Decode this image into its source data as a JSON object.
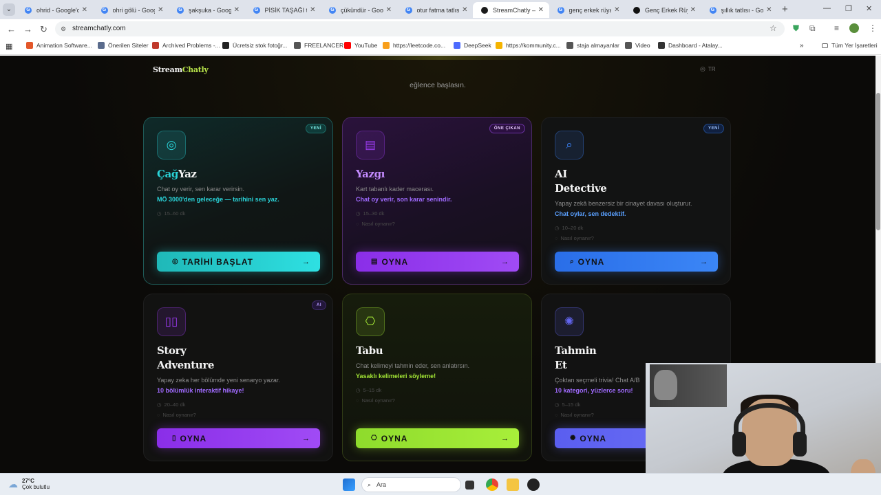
{
  "browser": {
    "tabs": [
      {
        "title": "ohrid - Google'da",
        "icon": "google-g-icon",
        "color": "#4285f4"
      },
      {
        "title": "ohri gölü - Google",
        "icon": "google-g-icon",
        "color": "#4285f4"
      },
      {
        "title": "şakşuka - Google",
        "icon": "google-g-icon",
        "color": "#4285f4"
      },
      {
        "title": "PİSİK TAŞAĞI tatlıs",
        "icon": "google-g-icon",
        "color": "#4285f4"
      },
      {
        "title": "çükündür - Google",
        "icon": "google-g-icon",
        "color": "#4285f4"
      },
      {
        "title": "otur fatma tatlısı",
        "icon": "google-g-icon",
        "color": "#4285f4"
      },
      {
        "title": "StreamChatly — İ",
        "icon": "streamchatly-icon",
        "color": "#1a1a1a"
      },
      {
        "title": "genç erkek rüyası",
        "icon": "google-g-icon",
        "color": "#4285f4"
      },
      {
        "title": "Genç Erkek Rüyas",
        "icon": "tiktok-icon",
        "color": "#111111"
      },
      {
        "title": "şıllık tatlısı - Goog",
        "icon": "google-g-icon",
        "color": "#4285f4"
      }
    ],
    "url": "streamchatly.com",
    "bookmarks": [
      {
        "label": "Animation Software...",
        "color": "#e3572a"
      },
      {
        "label": "Önerilen Siteler",
        "color": "#5a6b8c"
      },
      {
        "label": "Archived Problems -...",
        "color": "#c0392b"
      },
      {
        "label": "Ücretsiz stok fotoğr...",
        "color": "#222222"
      },
      {
        "label": "FREELANCER",
        "color": "#555555"
      },
      {
        "label": "YouTube",
        "color": "#ff0000"
      },
      {
        "label": "https://leetcode.co...",
        "color": "#f89f1b"
      },
      {
        "label": "DeepSeek",
        "color": "#4d6bfe"
      },
      {
        "label": "https://kommunity.c...",
        "color": "#f5b400"
      },
      {
        "label": "staja almayanlar",
        "color": "#555555"
      },
      {
        "label": "Video",
        "color": "#555555"
      },
      {
        "label": "Dashboard - Atalay...",
        "color": "#333333"
      }
    ],
    "all_bookmarks": "Tüm Yer İşaretleri"
  },
  "site": {
    "logo_a": "Stream",
    "logo_b": "Chatly",
    "lang": "TR",
    "tagline": "eğlence başlasın."
  },
  "cards": [
    {
      "title_a": "Çağ",
      "title_b": "Yaz",
      "badge": "YENİ",
      "desc": "Chat oy verir, sen karar verirsin.",
      "highlight": "MÖ 3000'den geleceğe — tarihini sen yaz.",
      "duration": "15–60 dk",
      "howto": "",
      "button": "TARİHİ BAŞLAT",
      "accent": "#2ad4d9"
    },
    {
      "title_a": "Yazgı",
      "title_b": "",
      "badge": "ÖNE ÇIKAN",
      "desc": "Kart tabanlı kader macerası.",
      "highlight": "Chat oy verir, son karar senindir.",
      "duration": "15–30 dk",
      "howto": "Nasıl oynanır?",
      "button": "OYNA",
      "accent": "#9b3bf0"
    },
    {
      "title_a": "AI",
      "title_b": "Detective",
      "badge": "YENİ",
      "desc": "Yapay zekâ benzersiz bir cinayet davası oluşturur.",
      "highlight": "Chat oylar, sen dedektif.",
      "duration": "10–20 dk",
      "howto": "Nasıl oynanır?",
      "button": "OYNA",
      "accent": "#3b82f6"
    },
    {
      "title_a": "Story",
      "title_b": "Adventure",
      "badge": "AI",
      "desc": "Yapay zeka her bölümde yeni senaryo yazar.",
      "highlight": "10 bölümlük interaktif hikaye!",
      "duration": "20–40 dk",
      "howto": "Nasıl oynanır?",
      "button": "OYNA",
      "accent": "#9b3bf0"
    },
    {
      "title_a": "Tabu",
      "title_b": "",
      "badge": "",
      "desc": "Chat kelimeyi tahmin eder, sen anlatırsın.",
      "highlight": "Yasaklı kelimeleri söyleme!",
      "duration": "5–15 dk",
      "howto": "Nasıl oynanır?",
      "button": "OYNA",
      "accent": "#a3e635"
    },
    {
      "title_a": "Tahmin",
      "title_b": "Et",
      "badge": "",
      "desc": "Çoktan seçmeli trivia! Chat A/B",
      "highlight": "10 kategori, yüzlerce soru!",
      "duration": "5–15 dk",
      "howto": "Nasıl oynanır?",
      "button": "OYNA",
      "accent": "#6366f1"
    }
  ],
  "taskbar": {
    "temp": "27°C",
    "weather": "Çok bulutlu",
    "search": "Ara"
  }
}
